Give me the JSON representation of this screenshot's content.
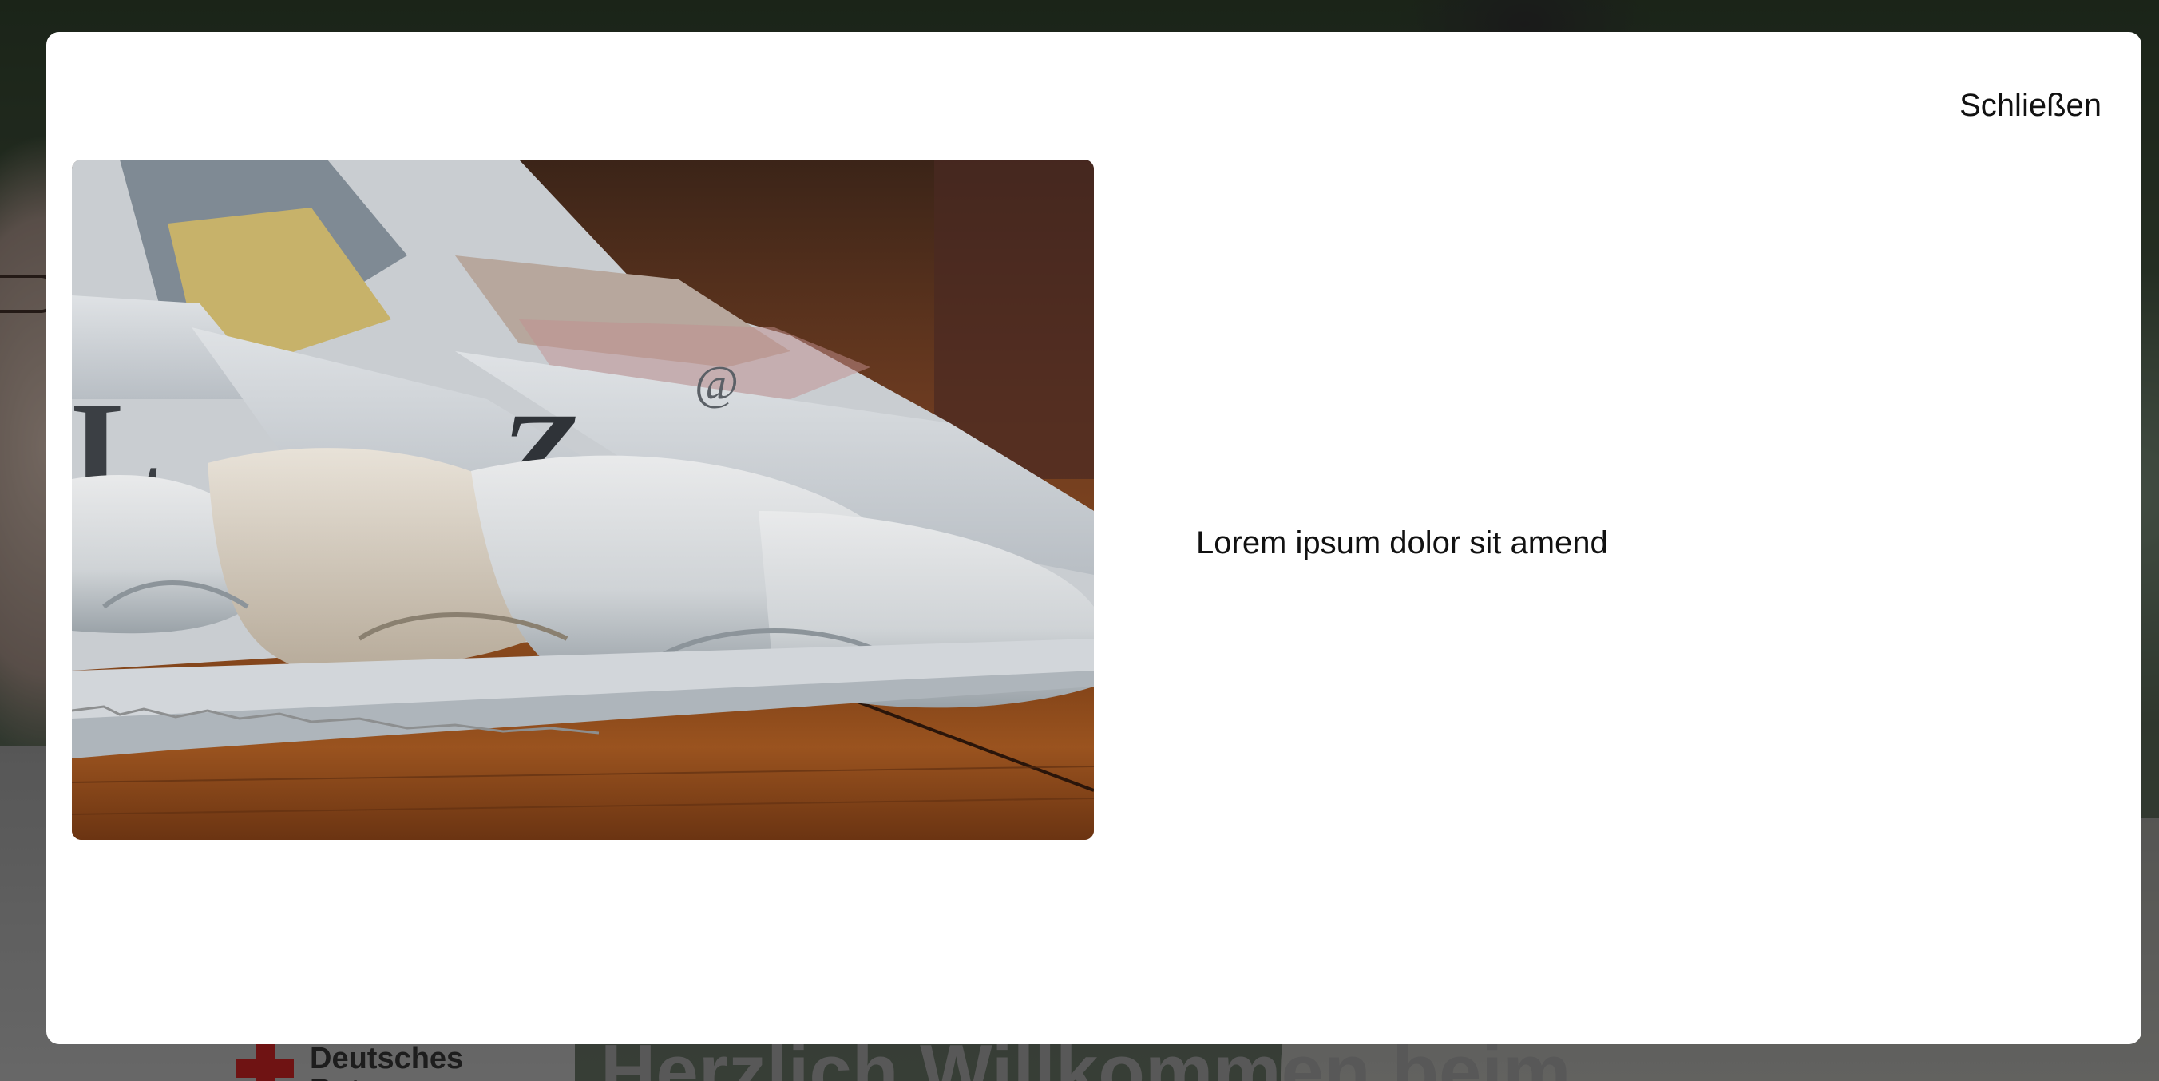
{
  "modal": {
    "close_label": "Schließen",
    "text": "Lorem ipsum dolor sit amend",
    "image_icon": "newspaper-photo"
  },
  "background": {
    "brand_name": "Deutsches Rotes",
    "hero_title": "Herzlich Willkommen beim"
  },
  "colors": {
    "modal_bg": "#ffffff",
    "overlay": "rgba(0,0,0,0.38)",
    "brand_red": "#b3201f"
  }
}
